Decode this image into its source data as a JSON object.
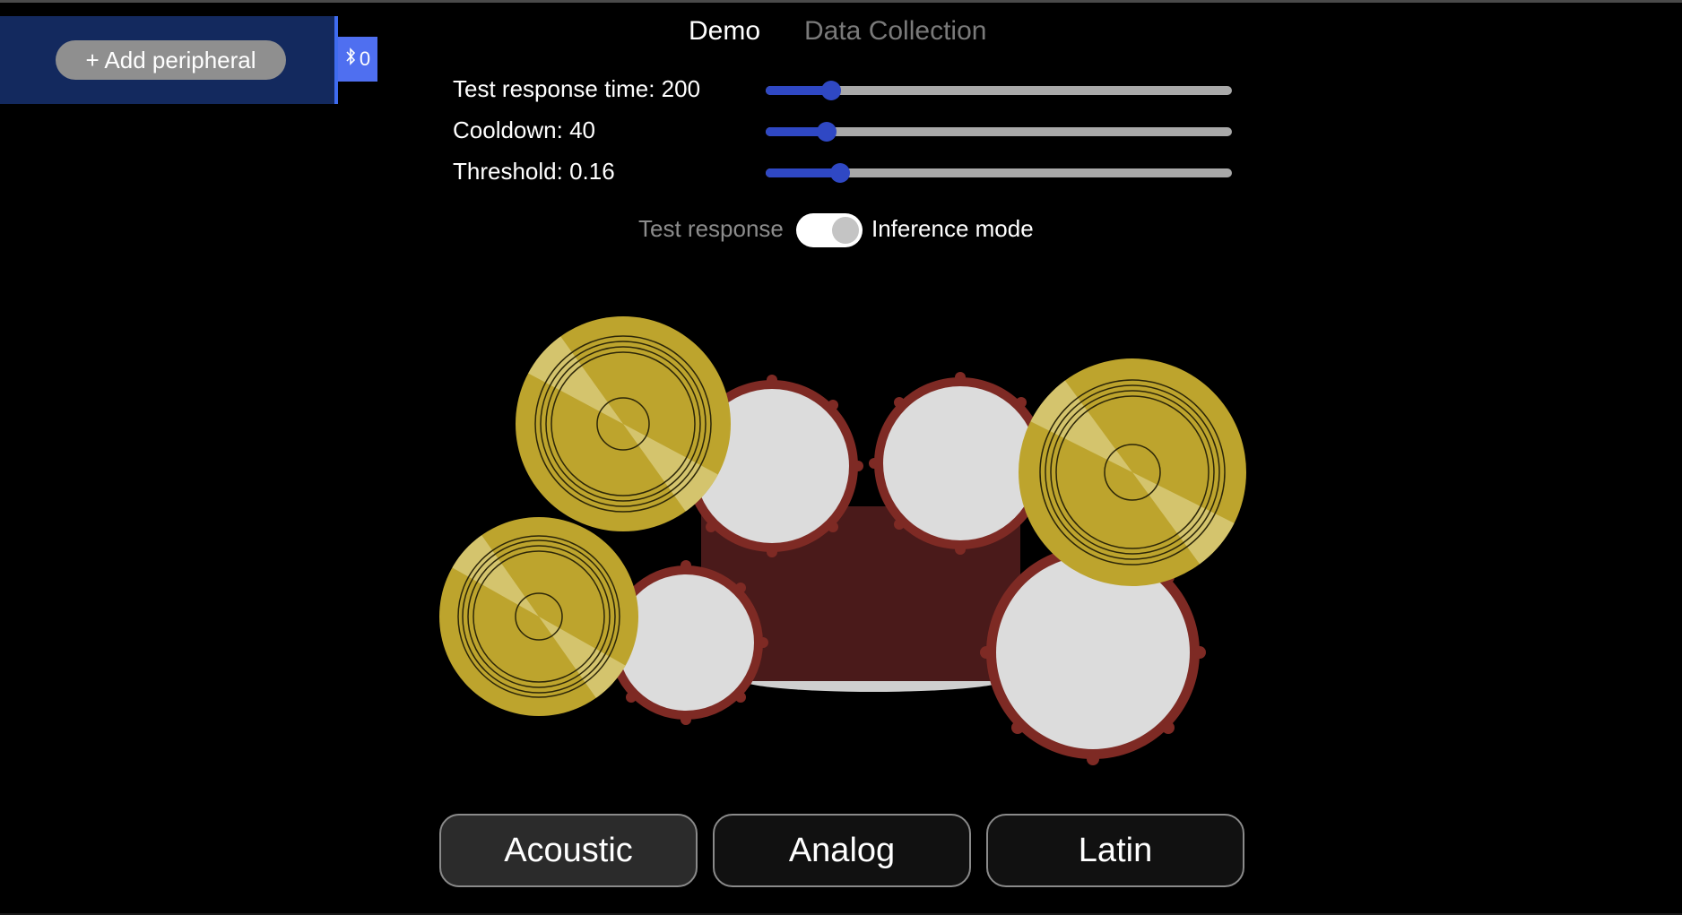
{
  "peripherals": {
    "add_label": "+ Add peripheral",
    "bluetooth_count": "0",
    "bluetooth_icon": "bluetooth-icon"
  },
  "tabs": [
    {
      "label": "Demo",
      "active": true
    },
    {
      "label": "Data Collection",
      "active": false
    }
  ],
  "sliders": [
    {
      "label": "Test response time: 200",
      "fraction": 0.14
    },
    {
      "label": "Cooldown: 40",
      "fraction": 0.13
    },
    {
      "label": "Threshold: 0.16",
      "fraction": 0.16
    }
  ],
  "mode_toggle": {
    "left_label": "Test response",
    "right_label": "Inference mode",
    "state": "inference"
  },
  "colors": {
    "accent": "#2f48c4",
    "cymbal": "#bda42d",
    "drum_rim": "#7e2a24",
    "drum_head": "#dcdcdc",
    "shell": "#4a1a1a"
  },
  "kits": [
    {
      "label": "Acoustic",
      "active": true
    },
    {
      "label": "Analog",
      "active": false
    },
    {
      "label": "Latin",
      "active": false
    }
  ]
}
